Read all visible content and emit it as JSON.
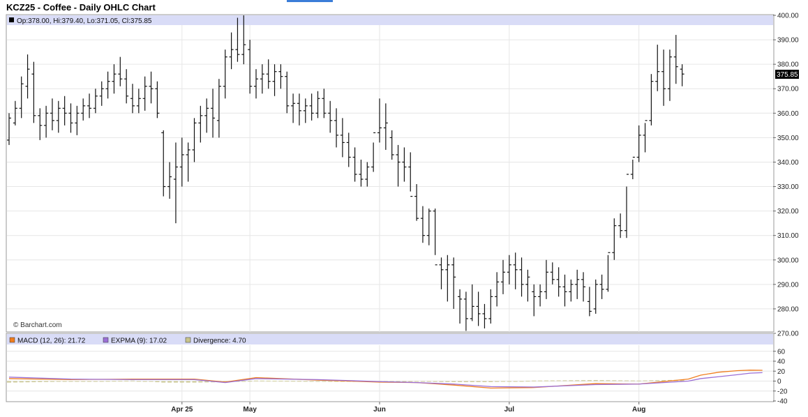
{
  "title": "KCZ25 - Coffee - Daily OHLC Chart",
  "info_line": "Op:378.00, Hi:379.40, Lo:371.05, Cl:375.85",
  "watermark": "© Barchart.com",
  "last_price_label": "375.85",
  "indicator_legend": [
    {
      "text": "MACD (12, 26): 21.72",
      "color": "#f07d1e"
    },
    {
      "text": "EXPMA (9): 17.02",
      "color": "#9b6fd6"
    },
    {
      "text": "Divergence: 4.70",
      "color": "#c8c48c"
    }
  ],
  "chart_data": [
    {
      "type": "ohlc",
      "title": "KCZ25 - Coffee - Daily OHLC Chart",
      "ylim": [
        270,
        400
      ],
      "yticks": [
        "270.00",
        "280.00",
        "290.00",
        "300.00",
        "310.00",
        "320.00",
        "330.00",
        "340.00",
        "350.00",
        "360.00",
        "370.00",
        "380.00",
        "390.00",
        "400.00"
      ],
      "xticks": [
        {
          "label": "Apr 25",
          "index": 28
        },
        {
          "label": "May",
          "index": 39
        },
        {
          "label": "Jun",
          "index": 60
        },
        {
          "label": "Jul",
          "index": 81
        },
        {
          "label": "Aug",
          "index": 102
        }
      ],
      "grid": true,
      "ohlc": [
        [
          349,
          360,
          347,
          358
        ],
        [
          356,
          365,
          355,
          362
        ],
        [
          362,
          375,
          358,
          372
        ],
        [
          371,
          384,
          366,
          378
        ],
        [
          376,
          381,
          356,
          359
        ],
        [
          359,
          362,
          349,
          355
        ],
        [
          355,
          363,
          350,
          360
        ],
        [
          360,
          366,
          353,
          357
        ],
        [
          357,
          365,
          352,
          362
        ],
        [
          362,
          367,
          355,
          360
        ],
        [
          360,
          364,
          352,
          356
        ],
        [
          356,
          363,
          351,
          360
        ],
        [
          360,
          366,
          357,
          363
        ],
        [
          363,
          368,
          358,
          362
        ],
        [
          362,
          370,
          360,
          367
        ],
        [
          367,
          373,
          363,
          370
        ],
        [
          370,
          377,
          366,
          373
        ],
        [
          373,
          380,
          368,
          376
        ],
        [
          376,
          383,
          371,
          374
        ],
        [
          374,
          378,
          364,
          367
        ],
        [
          366,
          372,
          360,
          363
        ],
        [
          363,
          370,
          360,
          366
        ],
        [
          366,
          375,
          361,
          371
        ],
        [
          371,
          377,
          364,
          370
        ],
        [
          370,
          373,
          358,
          360
        ],
        [
          352,
          353,
          326,
          330
        ],
        [
          330,
          340,
          325,
          334
        ],
        [
          333,
          348,
          315,
          338
        ],
        [
          338,
          350,
          330,
          343
        ],
        [
          343,
          348,
          332,
          345
        ],
        [
          345,
          358,
          340,
          356
        ],
        [
          356,
          363,
          348,
          359
        ],
        [
          359,
          366,
          352,
          362
        ],
        [
          362,
          370,
          350,
          358
        ],
        [
          357,
          374,
          350,
          371
        ],
        [
          371,
          386,
          366,
          383
        ],
        [
          383,
          393,
          378,
          386
        ],
        [
          386,
          399,
          381,
          384
        ],
        [
          384,
          400,
          380,
          388
        ],
        [
          386,
          390,
          368,
          371
        ],
        [
          371,
          378,
          366,
          374
        ],
        [
          374,
          380,
          368,
          376
        ],
        [
          376,
          382,
          370,
          373
        ],
        [
          373,
          380,
          367,
          377
        ],
        [
          377,
          380,
          370,
          375
        ],
        [
          375,
          377,
          360,
          363
        ],
        [
          363,
          368,
          356,
          364
        ],
        [
          364,
          368,
          355,
          361
        ],
        [
          361,
          366,
          356,
          363
        ],
        [
          363,
          368,
          357,
          360
        ],
        [
          360,
          369,
          358,
          366
        ],
        [
          366,
          370,
          358,
          360
        ],
        [
          360,
          365,
          352,
          357
        ],
        [
          357,
          362,
          346,
          351
        ],
        [
          351,
          358,
          342,
          348
        ],
        [
          348,
          352,
          338,
          342
        ],
        [
          342,
          346,
          332,
          335
        ],
        [
          335,
          341,
          330,
          333
        ],
        [
          333,
          340,
          330,
          338
        ],
        [
          338,
          348,
          336,
          352
        ],
        [
          352,
          366,
          348,
          354
        ],
        [
          354,
          364,
          345,
          356
        ],
        [
          350,
          353,
          341,
          343
        ],
        [
          343,
          347,
          330,
          340
        ],
        [
          340,
          346,
          332,
          338
        ],
        [
          338,
          344,
          328,
          326
        ],
        [
          326,
          331,
          316,
          317
        ],
        [
          317,
          322,
          307,
          310
        ],
        [
          310,
          321,
          306,
          320
        ],
        [
          320,
          321,
          302,
          298
        ],
        [
          298,
          301,
          288,
          296
        ],
        [
          296,
          302,
          283,
          298
        ],
        [
          298,
          301,
          280,
          293
        ],
        [
          285,
          288,
          274,
          284
        ],
        [
          284,
          287,
          271,
          276
        ],
        [
          276,
          290,
          275,
          281
        ],
        [
          281,
          287,
          273,
          278
        ],
        [
          278,
          282,
          272,
          276
        ],
        [
          276,
          288,
          274,
          285
        ],
        [
          285,
          295,
          281,
          291
        ],
        [
          291,
          300,
          286,
          295
        ],
        [
          295,
          302,
          290,
          298
        ],
        [
          298,
          303,
          288,
          296
        ],
        [
          296,
          301,
          285,
          290
        ],
        [
          290,
          296,
          283,
          293
        ],
        [
          287,
          290,
          277,
          285
        ],
        [
          285,
          290,
          281,
          287
        ],
        [
          287,
          300,
          284,
          295
        ],
        [
          295,
          299,
          290,
          292
        ],
        [
          292,
          297,
          285,
          289
        ],
        [
          289,
          294,
          281,
          287
        ],
        [
          287,
          292,
          283,
          290
        ],
        [
          290,
          296,
          284,
          292
        ],
        [
          292,
          295,
          283,
          289
        ],
        [
          283,
          289,
          277,
          279
        ],
        [
          280,
          292,
          278,
          290
        ],
        [
          290,
          294,
          284,
          288
        ],
        [
          288,
          302,
          287,
          303
        ],
        [
          303,
          317,
          300,
          314
        ],
        [
          314,
          319,
          309,
          312
        ],
        [
          312,
          330,
          309,
          335
        ],
        [
          335,
          341,
          333,
          342
        ],
        [
          342,
          355,
          340,
          351
        ],
        [
          351,
          356,
          344,
          357
        ],
        [
          357,
          376,
          355,
          373
        ],
        [
          373,
          388,
          369,
          377
        ],
        [
          377,
          386,
          363,
          370
        ],
        [
          370,
          386,
          365,
          383
        ],
        [
          383,
          392,
          372,
          379
        ],
        [
          378,
          380,
          371,
          376
        ]
      ]
    },
    {
      "type": "line",
      "title": "MACD (12, 26)",
      "ylim": [
        -40,
        40
      ],
      "yticks": [
        "-40",
        "-20",
        "0",
        "20",
        "40",
        "60"
      ],
      "series": [
        {
          "name": "MACD (12, 26)",
          "color": "#f07d1e",
          "x": [
            0,
            10,
            20,
            30,
            35,
            40,
            50,
            55,
            60,
            66,
            72,
            78,
            85,
            95,
            102,
            110,
            112,
            115,
            118,
            120,
            122
          ],
          "values": [
            5,
            3,
            4,
            4,
            -2,
            7,
            2,
            0,
            -2,
            -3,
            -8,
            -14,
            -13,
            -5,
            -6,
            4,
            12,
            18,
            21,
            22,
            21.72
          ]
        },
        {
          "name": "EXPMA (9)",
          "color": "#9b6fd6",
          "x": [
            0,
            10,
            20,
            30,
            35,
            40,
            50,
            55,
            60,
            66,
            72,
            78,
            85,
            95,
            102,
            110,
            112,
            115,
            118,
            120,
            122
          ],
          "values": [
            8,
            4,
            3,
            3,
            -3,
            5,
            3,
            1,
            -1,
            -3,
            -6,
            -11,
            -12,
            -7,
            -6,
            0,
            5,
            9,
            13,
            16,
            17.02
          ]
        },
        {
          "name": "Divergence",
          "color": "#c8c48c",
          "kind": "bar",
          "x": [
            0,
            10,
            20,
            25,
            30,
            35,
            40,
            50,
            55,
            60,
            66,
            72,
            78,
            85,
            95,
            102,
            110,
            112,
            115,
            118,
            120,
            122
          ],
          "values": [
            -3,
            -1,
            1,
            -3,
            -3,
            -2,
            1,
            0,
            -1,
            -2,
            -1,
            -2,
            -2,
            1,
            2,
            1,
            3,
            4,
            5,
            6,
            5.5,
            4.7
          ]
        }
      ]
    }
  ]
}
